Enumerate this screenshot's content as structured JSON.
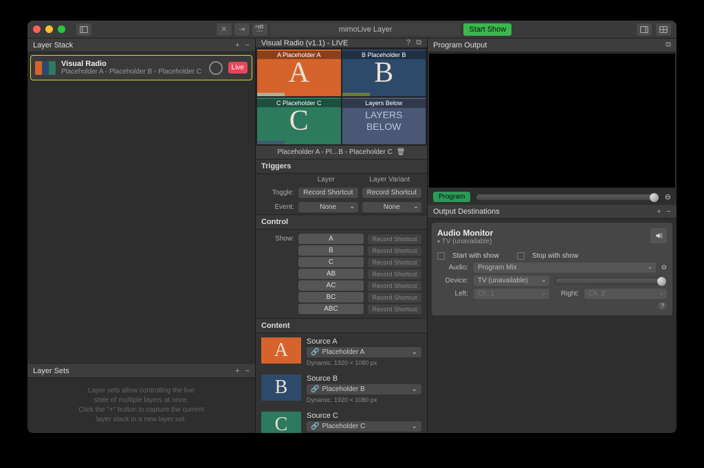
{
  "titlebar": {
    "title": "mimoLive Layer",
    "start_btn": "Start Show"
  },
  "layer_stack": {
    "header": "Layer Stack",
    "item": {
      "title": "Visual Radio",
      "subtitle": "Placeholder A - Placeholder B - Placeholder C",
      "live": "Live"
    }
  },
  "layer_sets": {
    "header": "Layer Sets",
    "empty": "Layer sets allow controlling the live\nstate of multiple layers at once.\nClick the \"+\" button to capture the current\nlayer stack in a new layer set."
  },
  "mid": {
    "header": "Visual Radio (v1.1) - LIVE",
    "cells": {
      "a": "A Placeholder A",
      "b": "B Placeholder B",
      "c": "C Placeholder C",
      "layers": "Layers Below",
      "layers_big1": "LAYERS",
      "layers_big2": "BELOW"
    },
    "preview_bar": "Placeholder A - Pl…B - Placeholder C",
    "triggers": {
      "head": "Triggers",
      "col1": "Layer",
      "col2": "Layer Variant",
      "toggle": "Toggle:",
      "event": "Event:",
      "rec": "Record Shortcut",
      "none": "None"
    },
    "control": {
      "head": "Control",
      "show": "Show:",
      "opts": [
        "A",
        "B",
        "C",
        "AB",
        "AC",
        "BC",
        "ABC"
      ],
      "rec": "Record Shortcut"
    },
    "content": {
      "head": "Content",
      "items": [
        {
          "title": "Source A",
          "sel": "Placeholder A",
          "meta": "Dynamic. 1920 × 1080 px",
          "color": "#d6632c",
          "letter": "A"
        },
        {
          "title": "Source B",
          "sel": "Placeholder B",
          "meta": "Dynamic. 1920 × 1080 px",
          "color": "#2d4a6b",
          "letter": "B"
        },
        {
          "title": "Source C",
          "sel": "Placeholder C",
          "meta": "",
          "color": "#2d7a5f",
          "letter": "C"
        }
      ]
    }
  },
  "right": {
    "program": "Program Output",
    "program_badge": "Program",
    "out_dest": "Output Destinations",
    "audio": {
      "title": "Audio Monitor",
      "sub": "TV (unavailable)",
      "start": "Start with show",
      "stop": "Stop with show",
      "audio_lbl": "Audio:",
      "audio_val": "Program Mix",
      "device_lbl": "Device:",
      "device_val": "TV (unavailable)",
      "left_lbl": "Left:",
      "left_val": "Ch. 1",
      "right_lbl": "Right:",
      "right_val": "Ch. 2"
    }
  }
}
